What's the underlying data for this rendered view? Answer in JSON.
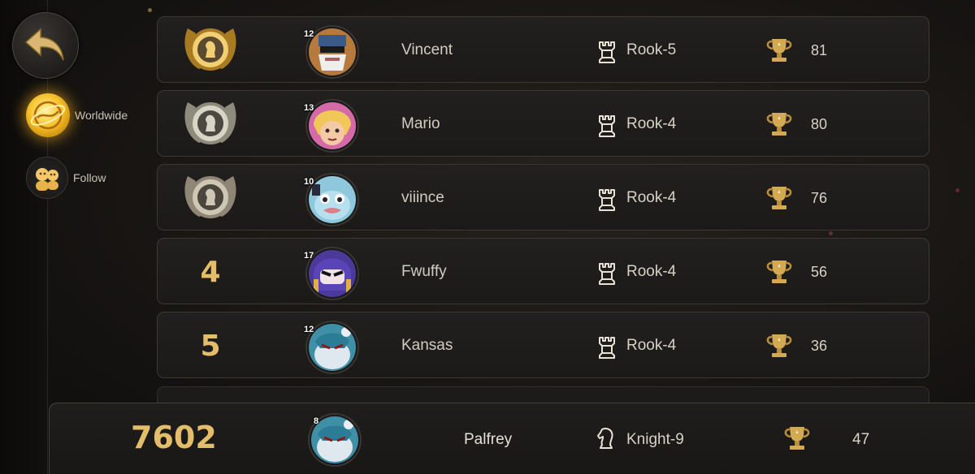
{
  "sidebar": {
    "back_icon": "back-arrow-icon",
    "tabs": [
      {
        "label": "Worldwide",
        "icon": "globe-icon",
        "active": true
      },
      {
        "label": "Follow",
        "icon": "friends-icon",
        "active": false
      }
    ]
  },
  "colors": {
    "rank_gold": "#e3bd6a",
    "active_tab": "#f6c12c",
    "row_bg": "#1f1d1b"
  },
  "leaderboard": [
    {
      "rank": "",
      "rank_badge": "gold-medal-icon",
      "level": "12",
      "avatar": "bearded-bandit-avatar",
      "name": "Vincent",
      "tier_icon": "rook-icon",
      "tier": "Rook-5",
      "trophy_icon": "trophy-icon",
      "trophies": "81"
    },
    {
      "rank": "",
      "rank_badge": "silver-medal-icon",
      "level": "13",
      "avatar": "blonde-girl-avatar",
      "name": "Mario",
      "tier_icon": "rook-icon",
      "tier": "Rook-4",
      "trophy_icon": "trophy-icon",
      "trophies": "80"
    },
    {
      "rank": "",
      "rank_badge": "bronze-medal-icon",
      "level": "10",
      "avatar": "blue-creature-avatar",
      "name": "viiince",
      "tier_icon": "rook-icon",
      "tier": "Rook-4",
      "trophy_icon": "trophy-icon",
      "trophies": "76"
    },
    {
      "rank": "4",
      "rank_badge": "",
      "level": "17",
      "avatar": "purple-ninja-avatar",
      "name": "Fwuffy",
      "tier_icon": "rook-icon",
      "tier": "Rook-4",
      "trophy_icon": "trophy-icon",
      "trophies": "56"
    },
    {
      "rank": "5",
      "rank_badge": "",
      "level": "12",
      "avatar": "furry-beast-avatar",
      "name": "Kansas",
      "tier_icon": "rook-icon",
      "tier": "Rook-4",
      "trophy_icon": "trophy-icon",
      "trophies": "36"
    }
  ],
  "self": {
    "rank": "7602",
    "level": "8",
    "avatar": "furry-beast-avatar",
    "name": "Palfrey",
    "tier_icon": "knight-icon",
    "tier": "Knight-9",
    "trophy_icon": "trophy-icon",
    "trophies": "47"
  }
}
